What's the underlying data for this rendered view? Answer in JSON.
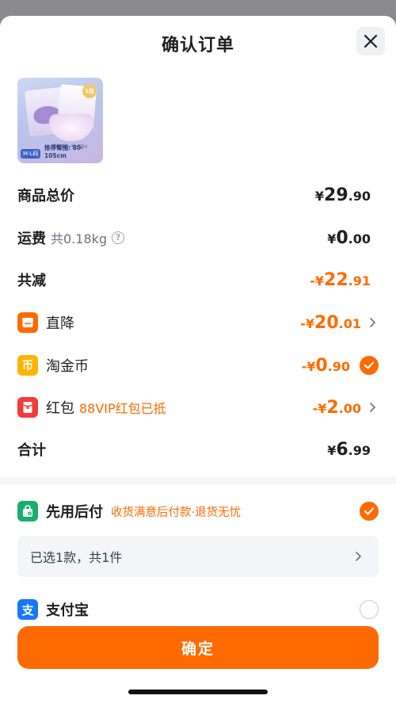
{
  "sheet": {
    "title": "确认订单",
    "close_icon": "close-icon"
  },
  "product": {
    "pack_badge": "1包",
    "size_tag": "M-L码",
    "size_text": "推荐臀围: 80-105cm",
    "weight_text": "推荐体重: 40-70kg"
  },
  "summary": {
    "total_label": "商品总价",
    "total_symbol": "¥",
    "total_int": "29",
    "total_dec": ".90",
    "shipping_label": "运费",
    "shipping_weight": "共0.18kg",
    "shipping_help_icon": "?",
    "shipping_symbol": "¥",
    "shipping_int": "0",
    "shipping_dec": ".00",
    "discount_label": "共减",
    "discount_symbol": "-¥",
    "discount_int": "22",
    "discount_dec": ".91",
    "direct_label": "直降",
    "direct_symbol": "-¥",
    "direct_int": "20",
    "direct_dec": ".01",
    "coin_label": "淘金币",
    "coin_symbol": "-¥",
    "coin_int": "0",
    "coin_dec": ".90",
    "coin_icon_char": "币",
    "redpacket_label": "红包",
    "redpacket_note": "88VIP红包已抵",
    "redpacket_symbol": "-¥",
    "redpacket_int": "2",
    "redpacket_dec": ".00",
    "grand_label": "合计",
    "grand_symbol": "¥",
    "grand_int": "6",
    "grand_dec": ".99"
  },
  "payment": {
    "bnpl_title": "先用后付",
    "bnpl_note": "收货满意后付款·退货无忧",
    "selected_text": "已选1款，共1件",
    "alipay_label": "支付宝",
    "alipay_icon_char": "支"
  },
  "confirm_label": "确定",
  "colors": {
    "accent": "#ff6a00",
    "alipay": "#1677ff",
    "bnpl_green": "#1aad6e",
    "coin_yellow": "#ffb400",
    "redpacket_red": "#f23b3b"
  }
}
